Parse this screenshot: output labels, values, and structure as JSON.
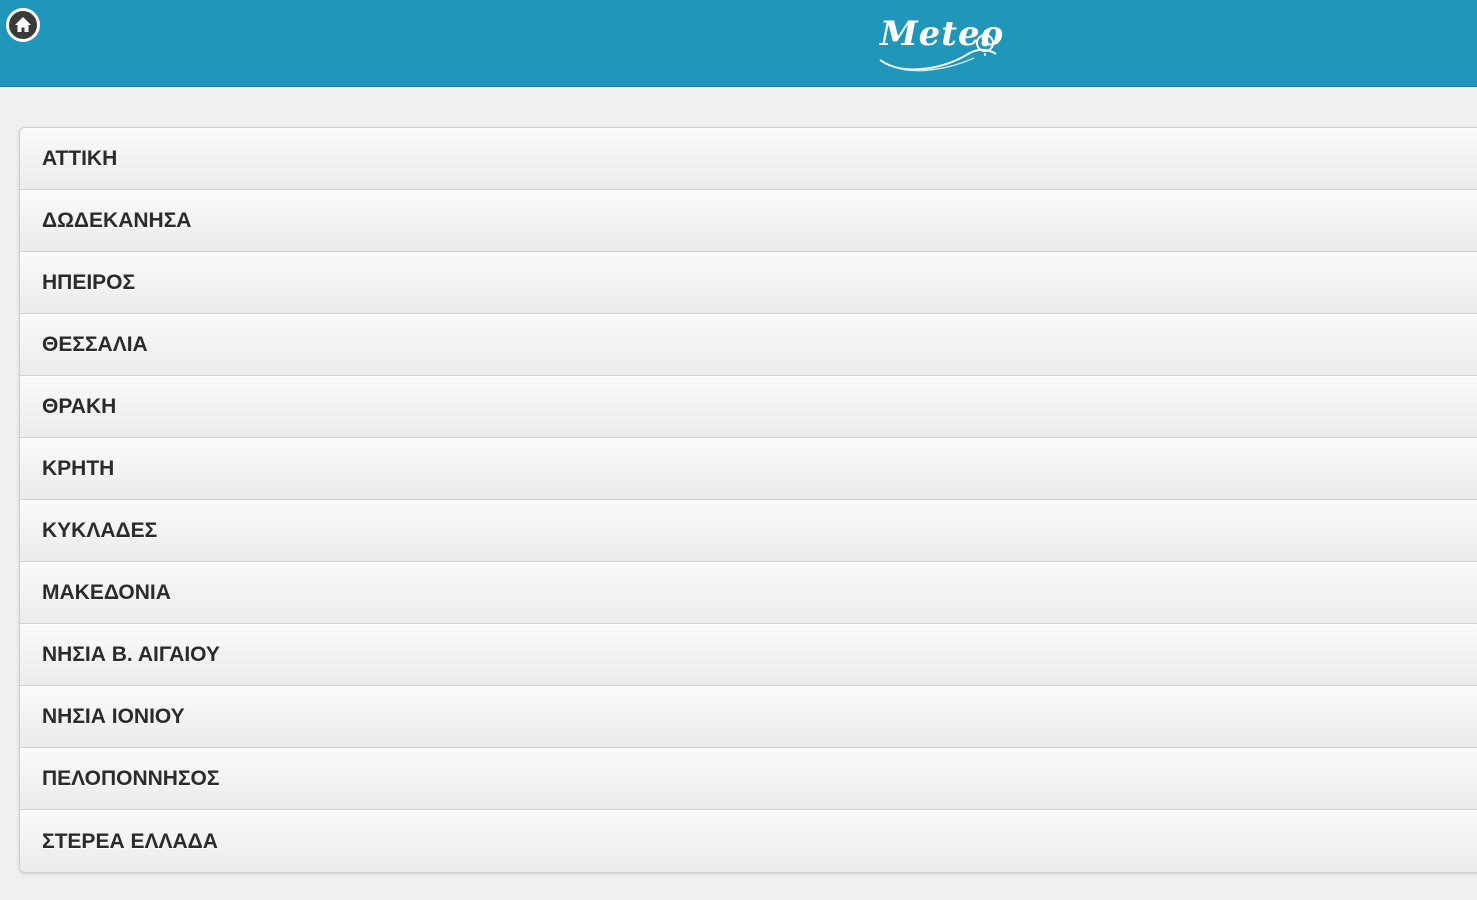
{
  "header": {
    "logo_text": "Meteo",
    "home_icon": "home-icon",
    "background_color": "#2196bb"
  },
  "regions": [
    {
      "label": "ΑΤΤΙΚΗ"
    },
    {
      "label": "ΔΩΔΕΚΑΝΗΣΑ"
    },
    {
      "label": "ΗΠΕΙΡΟΣ"
    },
    {
      "label": "ΘΕΣΣΑΛΙΑ"
    },
    {
      "label": "ΘΡΑΚΗ"
    },
    {
      "label": "ΚΡΗΤΗ"
    },
    {
      "label": "ΚΥΚΛΑΔΕΣ"
    },
    {
      "label": "ΜΑΚΕΔΟΝΙΑ"
    },
    {
      "label": "ΝΗΣΙΑ Β. ΑΙΓΑΙΟΥ"
    },
    {
      "label": "ΝΗΣΙΑ ΙΟΝΙΟΥ"
    },
    {
      "label": "ΠΕΛΟΠΟΝΝΗΣΟΣ"
    },
    {
      "label": "ΣΤΕΡΕΑ ΕΛΛΑΔΑ"
    }
  ]
}
